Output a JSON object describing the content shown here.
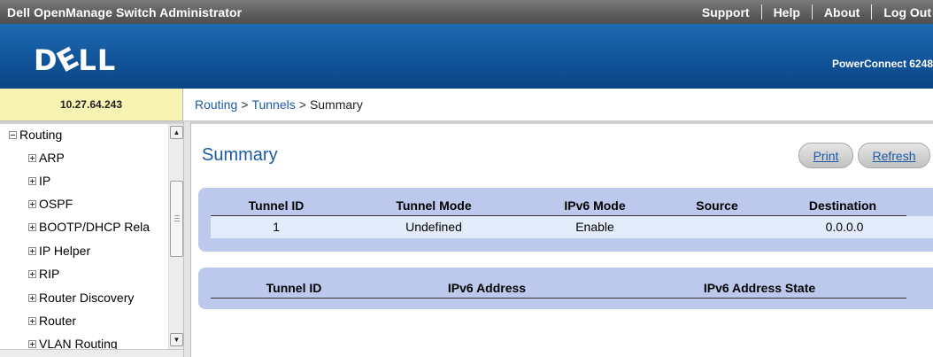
{
  "topbar": {
    "app_title": "Dell OpenManage Switch Administrator",
    "links": [
      "Support",
      "Help",
      "About",
      "Log Out"
    ]
  },
  "header": {
    "logo_text": "DELL",
    "product": "PowerConnect 6248"
  },
  "ip_address": "10.27.64.243",
  "breadcrumb": {
    "items": [
      "Routing",
      "Tunnels"
    ],
    "separator": ">",
    "current": "Summary"
  },
  "sidebar": {
    "root": "Routing",
    "items": [
      "ARP",
      "IP",
      "OSPF",
      "BOOTP/DHCP Rela",
      "IP Helper",
      "RIP",
      "Router Discovery",
      "Router",
      "VLAN Routing"
    ]
  },
  "main": {
    "title": "Summary",
    "print_label": "Print",
    "refresh_label": "Refresh",
    "tunnel_table": {
      "headers": [
        "Tunnel ID",
        "Tunnel Mode",
        "IPv6 Mode",
        "Source",
        "Destination"
      ],
      "rows": [
        [
          "1",
          "Undefined",
          "Enable",
          "",
          "0.0.0.0"
        ]
      ]
    },
    "address_table": {
      "headers": [
        "Tunnel ID",
        "IPv6 Address",
        "IPv6 Address State"
      ],
      "rows": []
    }
  },
  "colors": {
    "topbar": "#5c5c5c",
    "header_blue": "#0f4f93",
    "link_blue": "#1c5aa6",
    "panel": "#bcc8ec",
    "row": "#e3ecfb",
    "ip_bar": "#f7f3b2"
  }
}
